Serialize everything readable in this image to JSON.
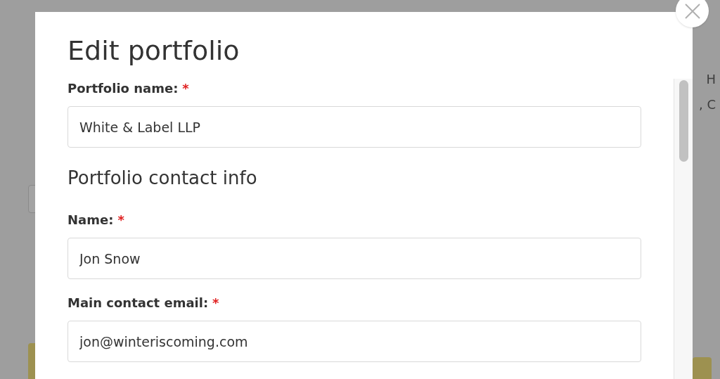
{
  "background": {
    "left_items": [
      {
        "kind": "field"
      },
      {
        "kind": "button"
      }
    ],
    "right_items": [
      {
        "kind": "text",
        "text": "H"
      },
      {
        "kind": "text",
        "text": ", C"
      },
      {
        "kind": "button"
      }
    ]
  },
  "modal": {
    "title": "Edit portfolio",
    "items": [
      {
        "kind": "field",
        "label": "Portfolio name:",
        "required_mark": "*",
        "value": "White & Label LLP"
      },
      {
        "kind": "heading",
        "text": "Portfolio contact info"
      },
      {
        "kind": "field",
        "label": "Name:",
        "required_mark": "*",
        "value": "Jon Snow"
      },
      {
        "kind": "field",
        "label": "Main contact email:",
        "required_mark": "*",
        "value": "jon@winteriscoming.com"
      }
    ]
  }
}
